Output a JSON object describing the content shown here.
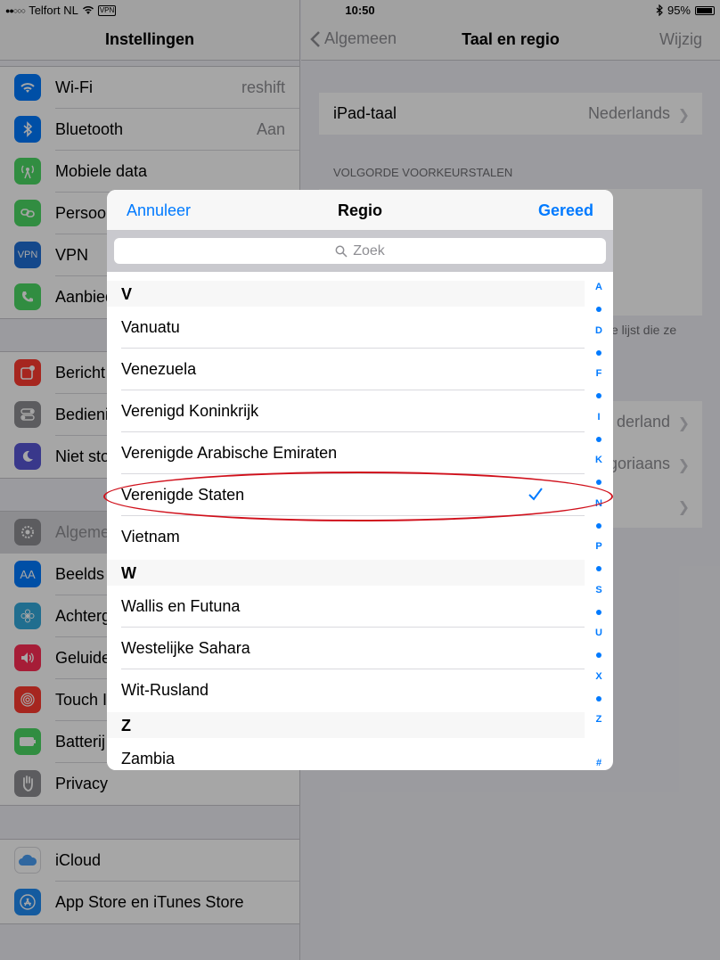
{
  "status": {
    "carrier": "Telfort NL",
    "signal_dots": "●●○○○",
    "vpn": "VPN",
    "time": "10:50",
    "battery": "95%",
    "battery_level": 0.95
  },
  "master": {
    "title": "Instellingen",
    "group1": [
      {
        "label": "Wi-Fi",
        "value": "reshift",
        "icon": "wifi-icon",
        "color": "#007aff"
      },
      {
        "label": "Bluetooth",
        "value": "Aan",
        "icon": "bluetooth-icon",
        "color": "#007aff"
      },
      {
        "label": "Mobiele data",
        "value": "",
        "icon": "antenna-icon",
        "color": "#4cd964"
      },
      {
        "label": "Persoo",
        "value": "",
        "icon": "hotspot-icon",
        "color": "#4cd964"
      },
      {
        "label": "VPN",
        "value": "",
        "icon": "vpn-icon",
        "color": "#007aff"
      },
      {
        "label": "Aanbied",
        "value": "",
        "icon": "phone-icon",
        "color": "#4cd964"
      }
    ],
    "group2": [
      {
        "label": "Bericht",
        "icon": "notifications-icon",
        "color": "#ff3b30"
      },
      {
        "label": "Bedieni",
        "icon": "control-center-icon",
        "color": "#8e8e93"
      },
      {
        "label": "Niet sto",
        "icon": "moon-icon",
        "color": "#5856d6"
      }
    ],
    "group3": [
      {
        "label": "Algeme",
        "icon": "gear-icon",
        "color": "#8e8e93",
        "selected": true
      },
      {
        "label": "Beelds",
        "icon": "text-size-icon",
        "color": "#007aff"
      },
      {
        "label": "Achterg",
        "icon": "wallpaper-icon",
        "color": "#34aadc"
      },
      {
        "label": "Geluide",
        "icon": "speaker-icon",
        "color": "#ff2d55"
      },
      {
        "label": "Touch I",
        "icon": "fingerprint-icon",
        "color": "#ff3b30"
      },
      {
        "label": "Batterij",
        "icon": "battery-icon",
        "color": "#4cd964"
      },
      {
        "label": "Privacy",
        "icon": "hand-icon",
        "color": "#8e8e93"
      }
    ],
    "group4": [
      {
        "label": "iCloud",
        "icon": "cloud-icon",
        "color": "#ffffff"
      },
      {
        "label": "App Store en iTunes Store",
        "icon": "app-store-icon",
        "color": "#007aff"
      }
    ]
  },
  "detail": {
    "back": "Algemeen",
    "title": "Taal en regio",
    "edit": "Wijzig",
    "ipad_language_label": "iPad-taal",
    "ipad_language_value": "Nederlands",
    "section_header": "VOLGORDE VOORKEURSTALEN",
    "footer_partial": "e lijst die ze",
    "region_partial": "derland",
    "calendar_partial": "goriaans"
  },
  "modal": {
    "cancel": "Annuleer",
    "title": "Regio",
    "done": "Gereed",
    "search_placeholder": "Zoek",
    "sections": [
      {
        "letter": "V",
        "items": [
          "Vanuatu",
          "Venezuela",
          "Verenigd Koninkrijk",
          "Verenigde Arabische Emiraten",
          "Verenigde Staten",
          "Vietnam"
        ]
      },
      {
        "letter": "W",
        "items": [
          "Wallis en Futuna",
          "Westelijke Sahara",
          "Wit-Rusland"
        ]
      },
      {
        "letter": "Z",
        "items": [
          "Zambia"
        ]
      }
    ],
    "selected": "Verenigde Staten",
    "index": [
      "A",
      "D",
      "F",
      "I",
      "K",
      "N",
      "P",
      "S",
      "U",
      "X",
      "Z",
      "#"
    ]
  }
}
